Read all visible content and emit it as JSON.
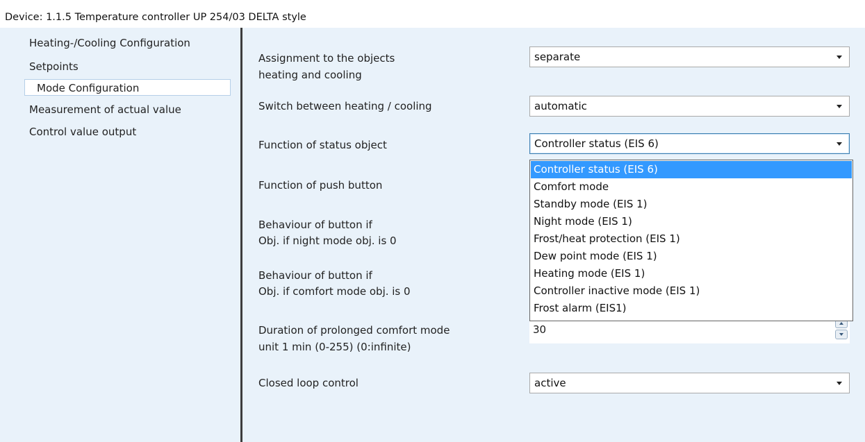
{
  "window": {
    "device_title": "Device: 1.1.5  Temperature controller UP 254/03 DELTA style"
  },
  "sidebar": {
    "items": [
      {
        "label": "Heating-/Cooling  Configuration"
      },
      {
        "label": "Setpoints"
      },
      {
        "label": "Mode  Configuration",
        "selected": true
      },
      {
        "label": "Measurement of actual value"
      },
      {
        "label": "Control value output"
      }
    ]
  },
  "params": {
    "assignment": {
      "label_line1": "Assignment to the objects",
      "label_line2": "heating and cooling",
      "value": "separate"
    },
    "switch": {
      "label": "Switch between heating / cooling",
      "value": "automatic"
    },
    "status_object": {
      "label": "Function of status object",
      "value": "Controller status (EIS 6)"
    },
    "push_button": {
      "label": "Function of push button"
    },
    "behaviour_night": {
      "label_line1": "Behaviour of button if",
      "label_line2": " Obj. if night mode obj. is 0"
    },
    "behaviour_comfort": {
      "label_line1": "Behaviour of button if",
      "label_line2": " Obj. if comfort mode obj. is 0"
    },
    "duration": {
      "label_line1": "Duration of prolonged comfort mode",
      "label_line2": "unit 1 min  (0-255)  (0:infinite)",
      "value": "30"
    },
    "closed_loop": {
      "label": "Closed loop control",
      "value": "active"
    }
  },
  "dropdown": {
    "selected_index": 0,
    "options": [
      "Controller status (EIS 6)",
      "Comfort mode",
      "Standby mode (EIS 1)",
      "Night mode (EIS 1)",
      "Frost/heat protection (EIS 1)",
      "Dew point mode (EIS 1)",
      "Heating mode (EIS 1)",
      "Controller inactive mode (EIS 1)",
      "Frost alarm (EIS1)"
    ]
  },
  "colors": {
    "panel_background": "#e9f2fa",
    "selection_highlight": "#3399ff",
    "splitter": "#3d3d3d"
  }
}
